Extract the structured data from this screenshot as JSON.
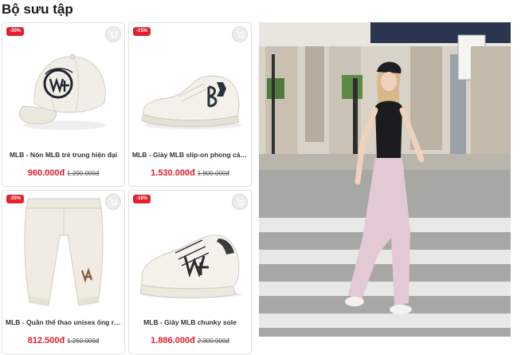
{
  "section": {
    "title": "Bộ sưu tập"
  },
  "products": [
    {
      "discount": "-20%",
      "name": "MLB - Nón MLB trẻ trung hiện đại",
      "price": "960.000đ",
      "old_price": "1.200.000đ"
    },
    {
      "discount": "-15%",
      "name": "MLB - Giày MLB slip-on phong cách",
      "price": "1.530.000đ",
      "old_price": "1.800.000đ"
    },
    {
      "discount": "-35%",
      "name": "MLB - Quần thể thao unisex ống rộng",
      "price": "812.500đ",
      "old_price": "1.250.000đ"
    },
    {
      "discount": "-18%",
      "name": "MLB - Giày MLB chunky sole",
      "price": "1.886.000đ",
      "old_price": "2.300.000đ"
    }
  ],
  "icons": {
    "wishlist": "cart-icon"
  },
  "colors": {
    "discount_badge": "#e5202e",
    "price": "#e21d2d"
  }
}
